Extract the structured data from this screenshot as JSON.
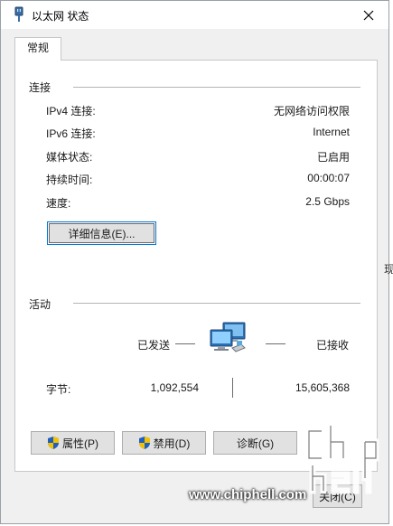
{
  "window": {
    "title": "以太网 状态",
    "close_glyph": "✕"
  },
  "tabs": [
    {
      "label": "常规"
    }
  ],
  "connection": {
    "group_title": "连接",
    "rows": [
      {
        "label": "IPv4 连接:",
        "value": "无网络访问权限"
      },
      {
        "label": "IPv6 连接:",
        "value": "Internet"
      },
      {
        "label": "媒体状态:",
        "value": "已启用"
      },
      {
        "label": "持续时间:",
        "value": "00:00:07"
      },
      {
        "label": "速度:",
        "value": "2.5 Gbps"
      }
    ],
    "details_button": "详细信息(E)..."
  },
  "activity": {
    "group_title": "活动",
    "sent_label": "已发送",
    "received_label": "已接收",
    "bytes_label": "字节:",
    "bytes_sent": "1,092,554",
    "bytes_received": "15,605,368"
  },
  "buttons": {
    "properties": "属性(P)",
    "disable": "禁用(D)",
    "diagnose": "诊断(G)",
    "close": "关闭(C)"
  },
  "watermark": {
    "text": "www.chiphell.com"
  },
  "background_edge_glyph": "现",
  "icons": {
    "title": "network-cable-icon",
    "shield": "uac-shield-icon",
    "activity": "network-computers-icon"
  },
  "colors": {
    "focus": "#0078d7",
    "shield_blue": "#1f5fbf",
    "shield_yellow": "#f2c200"
  }
}
